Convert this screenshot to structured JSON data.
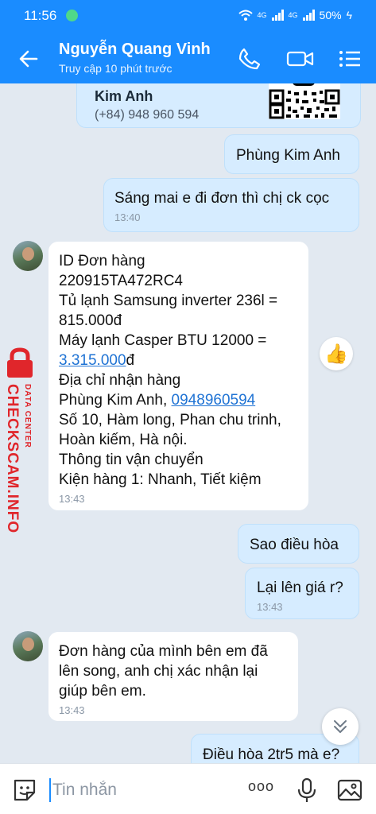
{
  "status_bar": {
    "time": "11:56",
    "network1": "4G",
    "network2": "4G",
    "battery": "50%"
  },
  "header": {
    "contact_name": "Nguyễn Quang Vinh",
    "last_seen": "Truy cập 10 phút trước"
  },
  "contact_card": {
    "name": "Kim Anh",
    "phone": "(+84) 948 960 594"
  },
  "messages": [
    {
      "text": "Phùng Kim Anh"
    },
    {
      "text": "Sáng mai e đi đơn thì chị ck cọc",
      "time": "13:40"
    },
    {
      "lines": [
        "ID Đơn hàng",
        "220915TA472RC4",
        "Tủ lạnh Samsung inverter 236l =",
        "815.000đ",
        "Máy lạnh Casper BTU 12000 ="
      ],
      "price_link": "3.315.000",
      "price_suffix": "đ",
      "address_label": "Địa chỉ nhận hàng",
      "recipient": "Phùng Kim Anh, ",
      "phone_link": "0948960594",
      "address_lines": [
        "Số 10, Hàm long, Phan chu trinh,",
        "Hoàn kiếm, Hà nội.",
        "Thông tin vận chuyển",
        "Kiện hàng 1: Nhanh, Tiết kiệm"
      ],
      "time": "13:43"
    },
    {
      "text": "Sao điều hòa"
    },
    {
      "text": "Lại lên giá r?",
      "time": "13:43"
    },
    {
      "lines": [
        "Đơn hàng của mình bên em đã",
        "lên song, anh chị xác nhận lại",
        "giúp bên em."
      ],
      "time": "13:43"
    },
    {
      "text": "Điều hòa 2tr5 mà e?"
    }
  ],
  "watermark": {
    "site": "CHECKSCAM.INFO",
    "tag": "DATA CENTER"
  },
  "reaction": {
    "emoji": "👍"
  },
  "input": {
    "placeholder": "Tin nhắn",
    "more": "ooo"
  },
  "colors": {
    "brand": "#1a8cff",
    "outgoing": "#d6ecff",
    "watermark": "#e0262b"
  }
}
